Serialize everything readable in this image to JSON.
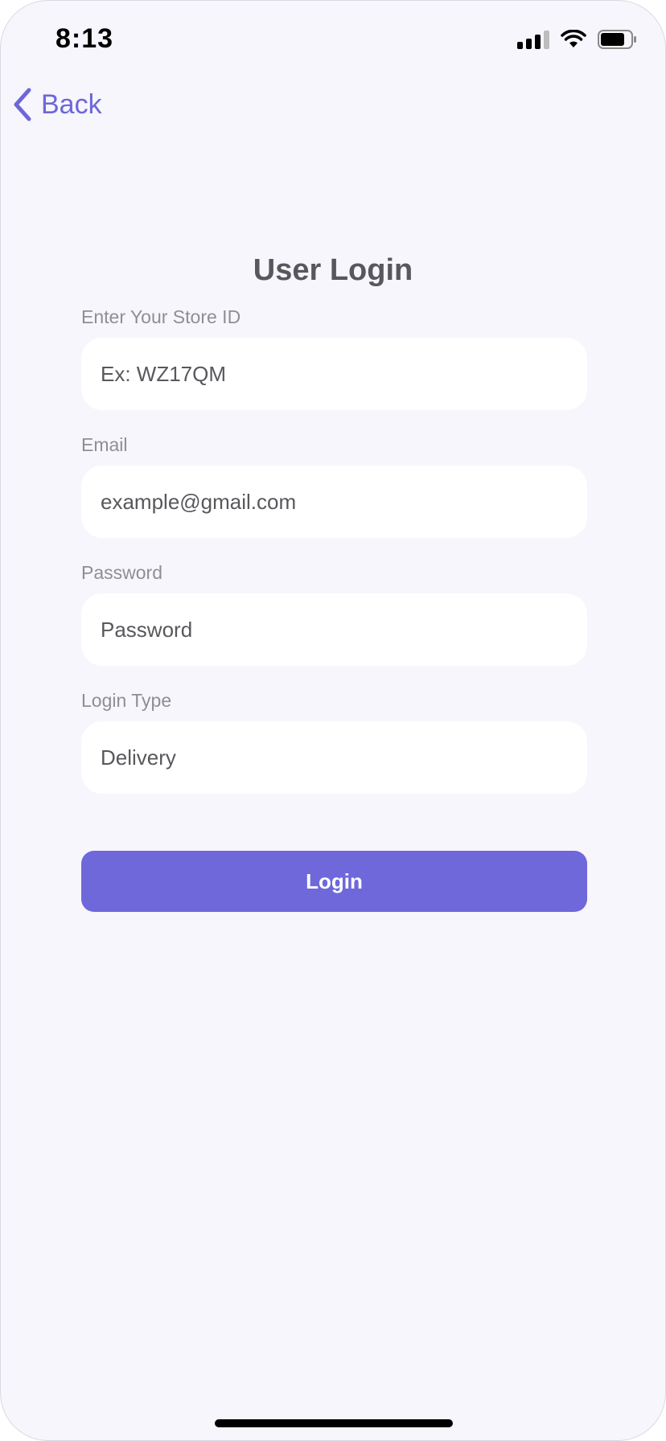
{
  "status_bar": {
    "time": "8:13"
  },
  "nav": {
    "back_label": "Back"
  },
  "page": {
    "title": "User Login"
  },
  "form": {
    "store_id": {
      "label": "Enter Your Store ID",
      "placeholder": "Ex: WZ17QM"
    },
    "email": {
      "label": "Email",
      "placeholder": "example@gmail.com"
    },
    "password": {
      "label": "Password",
      "placeholder": "Password"
    },
    "login_type": {
      "label": "Login Type",
      "value": "Delivery"
    },
    "submit_label": "Login"
  },
  "colors": {
    "accent": "#6e68db",
    "background": "#f6f6fc",
    "field_background": "#ffffff",
    "label": "#8e8e93",
    "text": "#58585c"
  },
  "icons": {
    "back": "chevron-left-icon",
    "signal": "cellular-signal-icon",
    "wifi": "wifi-icon",
    "battery": "battery-icon"
  }
}
